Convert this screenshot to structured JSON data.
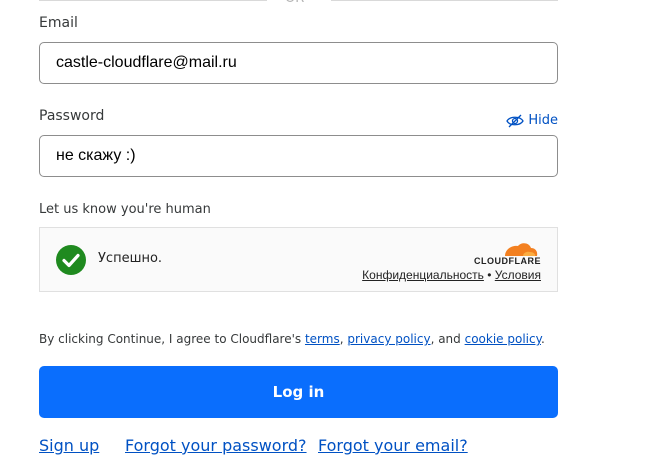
{
  "divider": {
    "text": "OR"
  },
  "email": {
    "label": "Email",
    "value": "castle-cloudflare@mail.ru"
  },
  "password": {
    "label": "Password",
    "value": "не скажу :)",
    "toggle_label": "Hide"
  },
  "captcha": {
    "label": "Let us know you're human",
    "status": "Успешно.",
    "brand": "CLOUDFLARE",
    "privacy_link": "Конфиденциальность",
    "separator": "•",
    "terms_link": "Условия",
    "colors": {
      "success": "#1f8a1f",
      "brand_orange": "#f38020"
    }
  },
  "consent": {
    "prefix": "By clicking Continue, I agree to Cloudflare's ",
    "terms": "terms",
    "comma": ", ",
    "privacy": "privacy policy",
    "and": ", and ",
    "cookie": "cookie policy",
    "suffix": "."
  },
  "login_button": {
    "label": "Log in",
    "color": "#0a6efd"
  },
  "links": {
    "sign_up": "Sign up",
    "forgot_password": "Forgot your password?",
    "forgot_email": "Forgot your email?"
  }
}
